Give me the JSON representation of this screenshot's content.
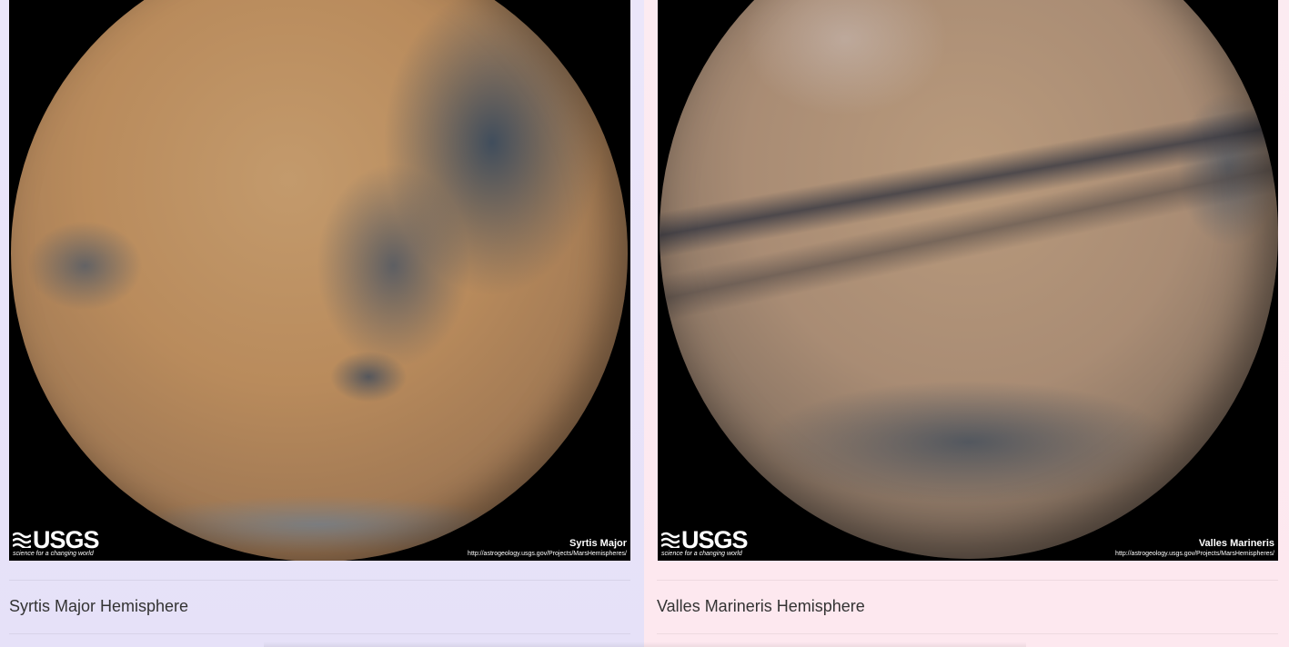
{
  "hemispheres": [
    {
      "title": "Syrtis Major Hemisphere",
      "image_caption": "Syrtis Major",
      "image_url_text": "http://astrogeology.usgs.gov/Projects/MarsHemispheres/",
      "logo_text": "USGS",
      "logo_tagline": "science for a changing world"
    },
    {
      "title": "Valles Marineris Hemisphere",
      "image_caption": "Valles Marineris",
      "image_url_text": "http://astrogeology.usgs.gov/Projects/MarsHemispheres/",
      "logo_text": "USGS",
      "logo_tagline": "science for a changing world"
    }
  ],
  "colors": {
    "left_panel_bg": "#e8e3f9",
    "right_panel_bg": "#fde9f0",
    "title_text": "#333333"
  }
}
